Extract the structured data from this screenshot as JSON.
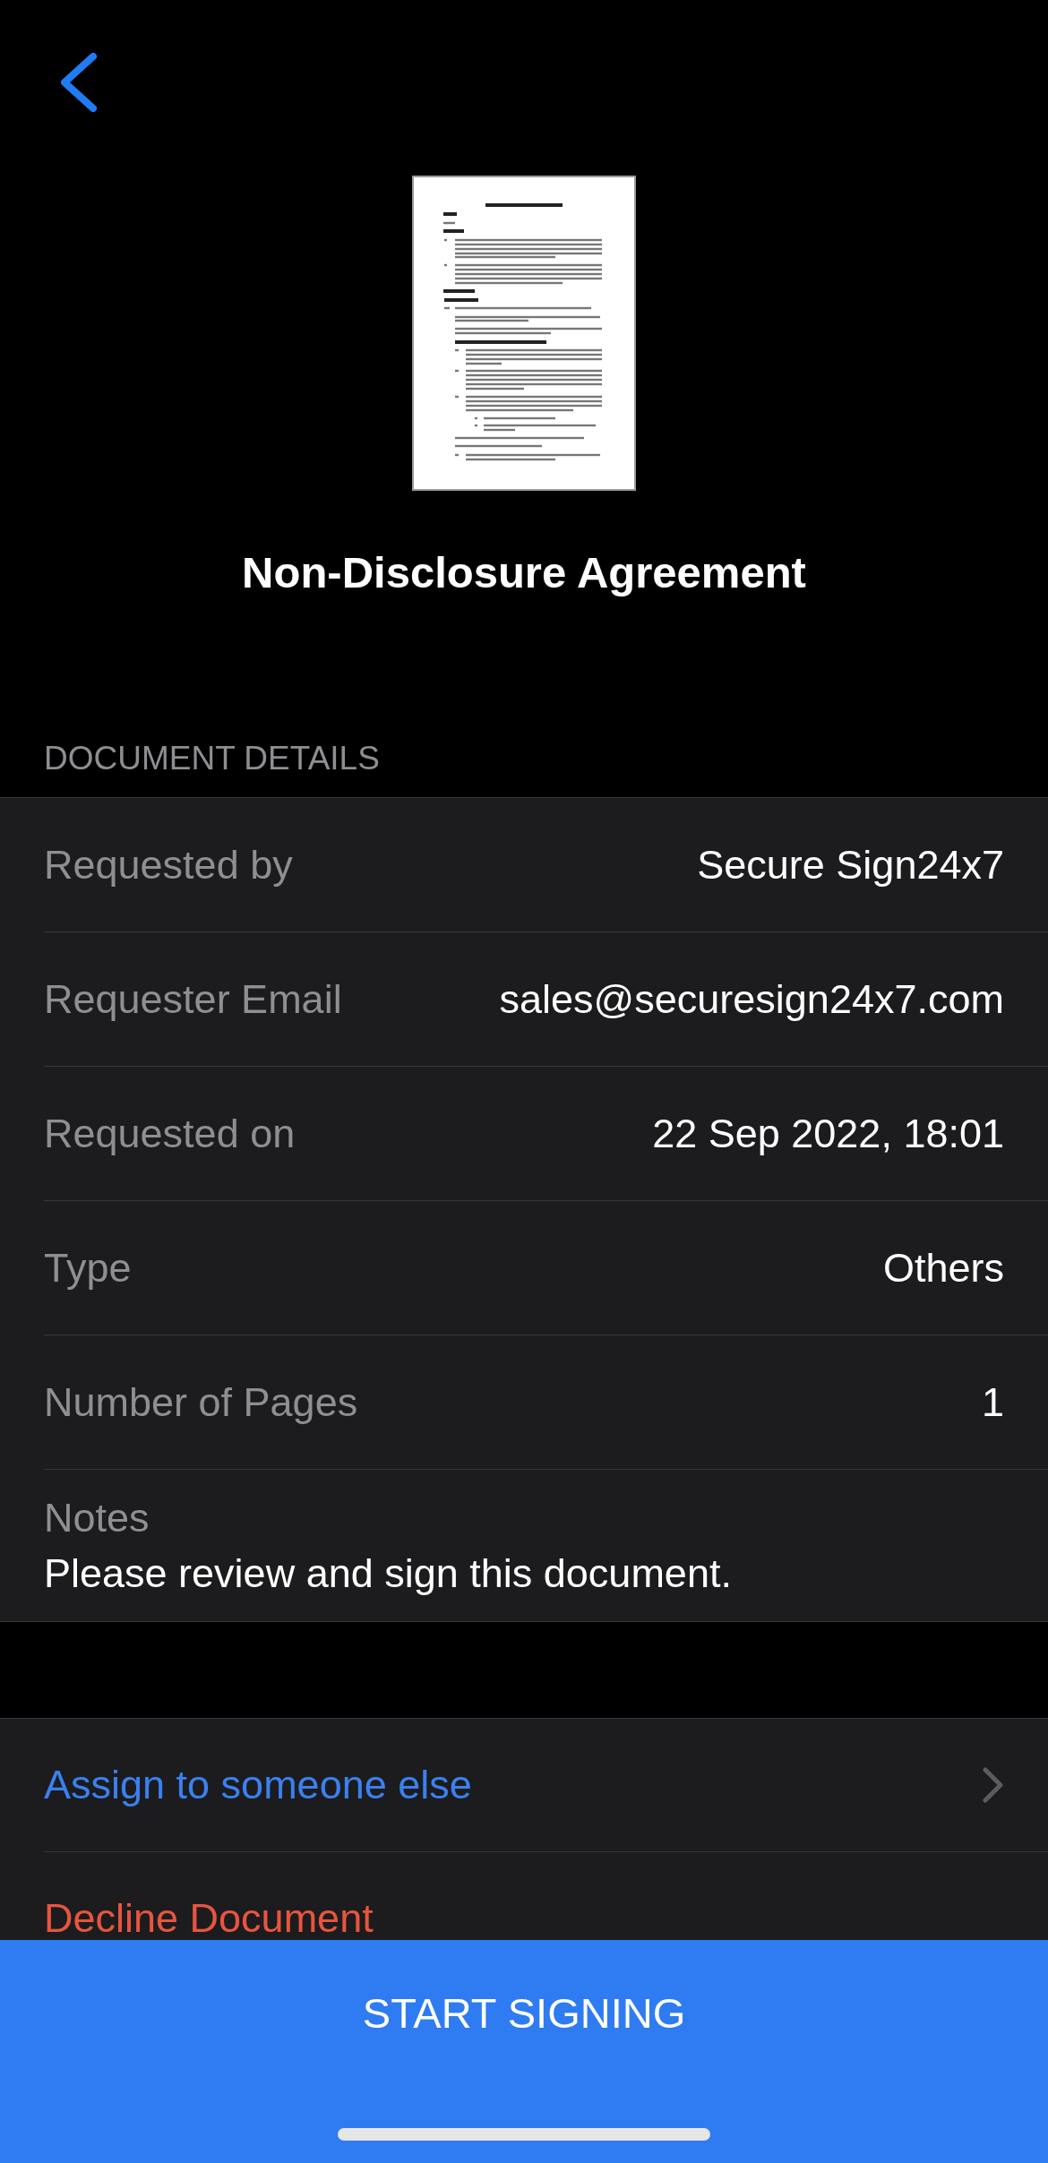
{
  "document": {
    "title": "Non-Disclosure Agreement"
  },
  "details": {
    "heading": "DOCUMENT DETAILS",
    "rows": [
      {
        "label": "Requested by",
        "value": "Secure Sign24x7"
      },
      {
        "label": "Requester Email",
        "value": "sales@securesign24x7.com"
      },
      {
        "label": "Requested on",
        "value": "22 Sep 2022, 18:01"
      },
      {
        "label": "Type",
        "value": "Others"
      },
      {
        "label": "Number of Pages",
        "value": "1"
      }
    ],
    "notes": {
      "label": "Notes",
      "text": "Please review and sign this document."
    }
  },
  "actions": [
    {
      "kind": "navigate",
      "label": "Assign to someone else"
    },
    {
      "kind": "destructive",
      "label": "Decline Document"
    }
  ],
  "primary_button": {
    "label": "START SIGNING"
  }
}
